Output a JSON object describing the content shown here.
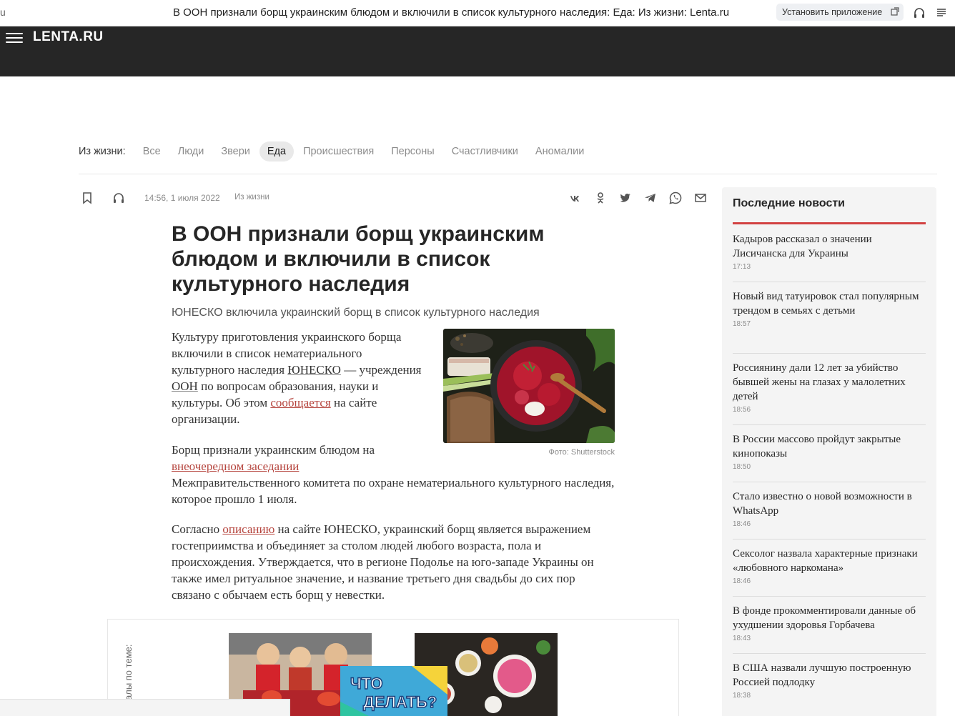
{
  "browser": {
    "url_fragment": "u",
    "window_title": "В ООН признали борщ украинским блюдом и включили в список культурного наследия: Еда: Из жизни: Lenta.ru",
    "install_label": "Установить приложение"
  },
  "header": {
    "logo": "LENTA.RU"
  },
  "rubric": {
    "label": "Из жизни:",
    "items": [
      "Все",
      "Люди",
      "Звери",
      "Еда",
      "Происшествия",
      "Персоны",
      "Счастливчики",
      "Аномалии"
    ],
    "active": "Еда"
  },
  "article": {
    "date": "14:56, 1 июля 2022",
    "rubric": "Из жизни",
    "title": "В ООН признали борщ украинским блюдом и включили в список культурного наследия",
    "lead": "ЮНЕСКО включила украинский борщ в список культурного наследия",
    "p1": {
      "t1": "Культуру приготовления украинского борща включили в список нематериального культурного наследия ",
      "unesco": "ЮНЕСКО",
      "t2": " — учреждения ",
      "oon": "ООН",
      "t3": " по вопросам образования, науки и культуры. Об этом ",
      "link": "сообщается",
      "t4": " на сайте организации."
    },
    "p2": {
      "t1": "Борщ признали украинским блюдом на",
      "link": "внеочередном заседании",
      "t2": "Межправительственного комитета по охране нематериального культурного наследия, которое прошло 1 июля."
    },
    "p3": {
      "t1": "Согласно ",
      "link": "описанию",
      "t2": " на сайте ЮНЕСКО, украинский борщ является выражением гостеприимства и объединяет за столом людей любого возраста, пола и происхождения. Утверждается, что в регионе Подолье на юго-западе Украины он также имел ритуальное значение, и название третьего дня свадьбы до сих пор связано с обычаем есть борщ у невестки."
    },
    "photo_credit": "Фото: Shutterstock"
  },
  "related": {
    "label": "алы по теме:",
    "badge_line1": "ЧТО",
    "badge_line2": "ДЕЛАТЬ?"
  },
  "sidebar": {
    "title": "Последние новости",
    "news": [
      {
        "title": "Кадыров рассказал о значении Лисичанска для Украины",
        "time": "17:13"
      },
      {
        "title": "Новый вид татуировок стал популярным трендом в семьях с детьми",
        "time": "18:57"
      },
      {
        "title": "Россиянину дали 12 лет за убийство бывшей жены на глазах у малолетних детей",
        "time": "18:56"
      },
      {
        "title": "В России массово пройдут закрытые кинопоказы",
        "time": "18:50"
      },
      {
        "title": "Стало известно о новой возможности в WhatsApp",
        "time": "18:46"
      },
      {
        "title": "Сексолог назвала характерные признаки «любовного наркомана»",
        "time": "18:46"
      },
      {
        "title": "В фонде прокомментировали данные об ухудшении здоровья Горбачева",
        "time": "18:43"
      },
      {
        "title": "В США назвали лучшую построенную Россией подлодку",
        "time": "18:38"
      }
    ]
  },
  "colors": {
    "header_bg": "#262626",
    "accent_red": "#d24141",
    "link_red": "#b5443d",
    "sidebar_bg": "#f4f4f4"
  },
  "icons": [
    "bookmark-icon",
    "headphones-icon",
    "vk-icon",
    "odnoklassniki-icon",
    "twitter-icon",
    "telegram-icon",
    "whatsapp-icon",
    "mail-icon",
    "menu-icon",
    "open-in-app-icon",
    "reader-mode-icon"
  ]
}
